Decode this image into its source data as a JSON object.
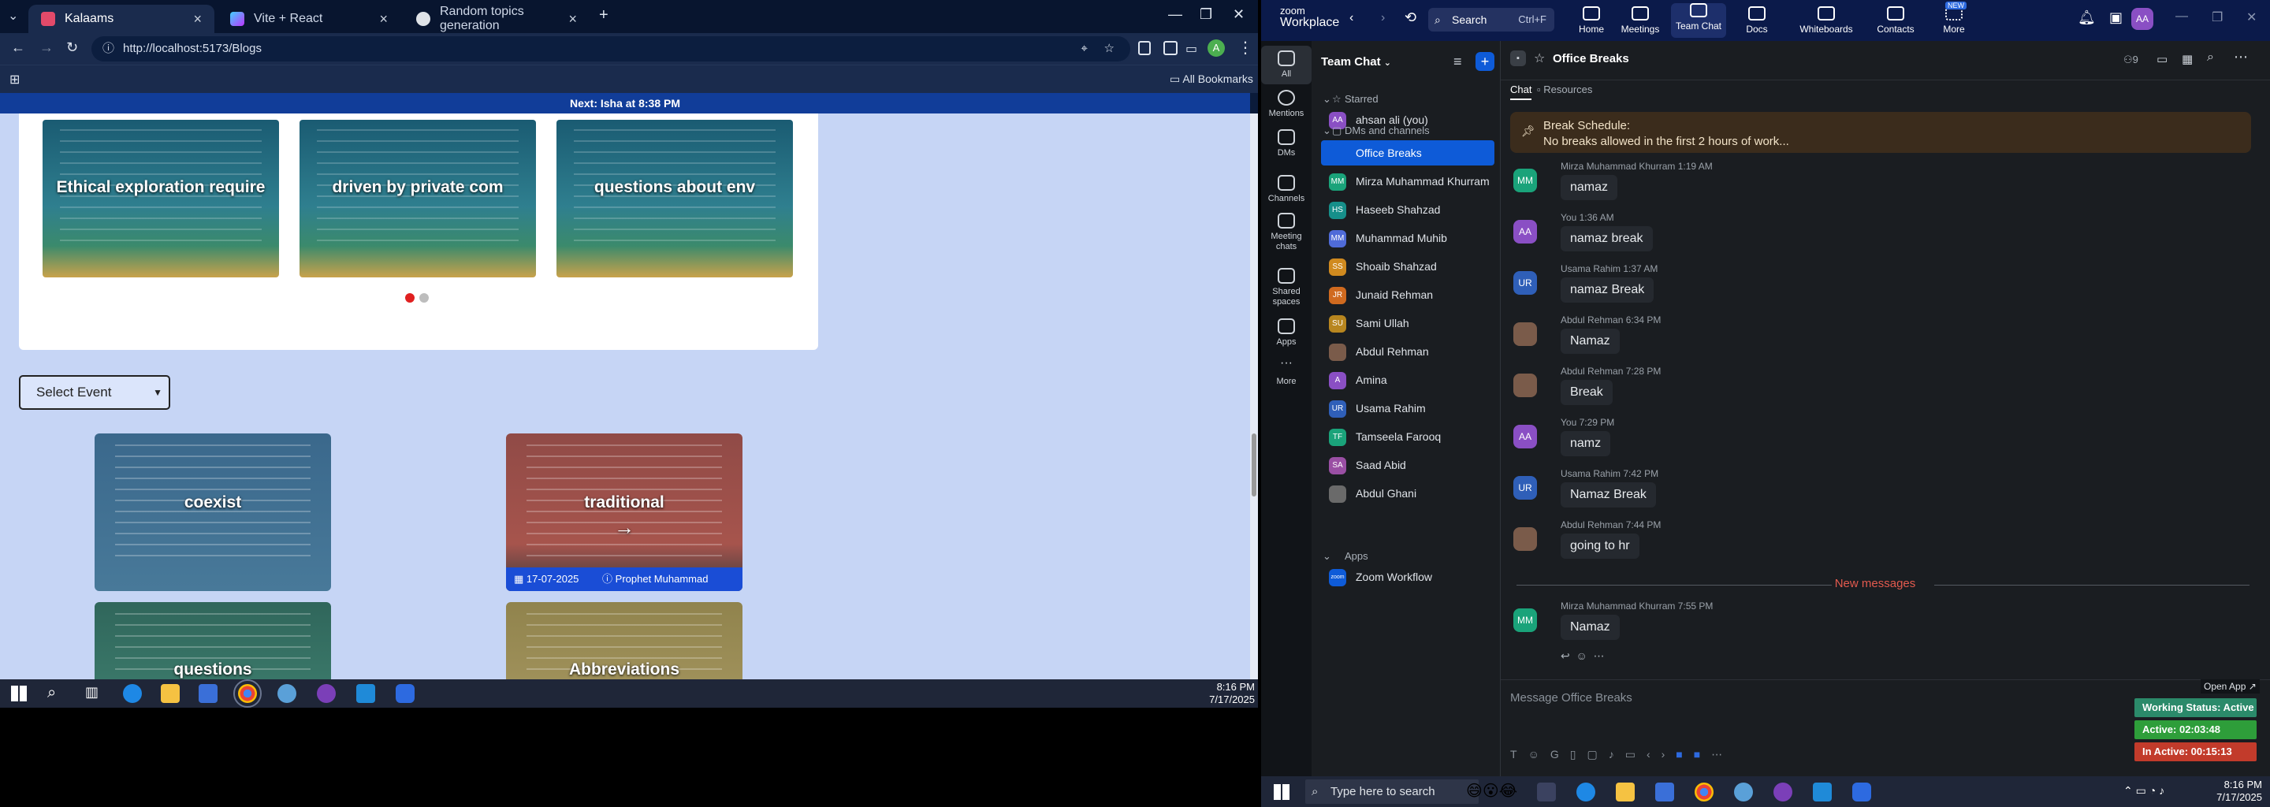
{
  "browser": {
    "tabs": [
      {
        "label": "Kalaams",
        "icon": "kalaams-favicon",
        "active": true
      },
      {
        "label": "Vite + React",
        "icon": "vite-favicon",
        "active": false
      },
      {
        "label": "Random topics generation",
        "icon": "chatgpt-favicon",
        "active": false
      }
    ],
    "url": "http://localhost:5173/Blogs",
    "all_bookmarks": "All Bookmarks",
    "profile_initial": "A"
  },
  "page": {
    "notice": "Next: Isha at 8:38 PM",
    "slides": [
      {
        "caption": "Ethical exploration require"
      },
      {
        "caption": "driven by private com"
      },
      {
        "caption": "questions about env"
      }
    ],
    "select_label": "Select Event",
    "events": [
      {
        "caption": "coexist"
      },
      {
        "caption": "traditional",
        "date": "17-07-2025",
        "author": "Prophet Muhammad (PBUH)",
        "arrow": "→"
      },
      {
        "caption": "questions"
      },
      {
        "caption": "Abbreviations"
      }
    ]
  },
  "left_taskbar": {
    "time": "8:16 PM",
    "date": "7/17/2025"
  },
  "zoom": {
    "brand_line1": "zoom",
    "brand_line2": "Workplace",
    "search_label": "Search",
    "search_shortcut": "Ctrl+F",
    "nav": [
      {
        "label": "Home"
      },
      {
        "label": "Meetings"
      },
      {
        "label": "Team Chat"
      },
      {
        "label": "Docs"
      },
      {
        "label": "Whiteboards"
      },
      {
        "label": "Contacts"
      },
      {
        "label": "More",
        "badge": "NEW"
      }
    ],
    "user_initials": "AA",
    "rail": [
      {
        "label": "All"
      },
      {
        "label": "Mentions"
      },
      {
        "label": "DMs"
      },
      {
        "label": "Channels"
      },
      {
        "label": "Meeting chats"
      },
      {
        "label": "Shared spaces"
      },
      {
        "label": "Apps"
      },
      {
        "label": "More"
      }
    ],
    "list_title": "Team Chat",
    "starred_label": "Starred",
    "starred_item": {
      "name": "ahsan ali (you)",
      "initials": "AA"
    },
    "dms_label": "DMs and channels",
    "channels": [
      {
        "name": "Office Breaks",
        "initials": "",
        "color": "#0e5bd8"
      },
      {
        "name": "Mirza Muhammad Khurram",
        "initials": "MM",
        "color": "#1aa37a"
      },
      {
        "name": "Haseeb Shahzad",
        "initials": "HS",
        "color": "#168f8a"
      },
      {
        "name": "Muhammad Muhib",
        "initials": "MM",
        "color": "#4f6bd8"
      },
      {
        "name": "Shoaib Shahzad",
        "initials": "SS",
        "color": "#d08a1f"
      },
      {
        "name": "Junaid Rehman",
        "initials": "JR",
        "color": "#d06a1f"
      },
      {
        "name": "Sami Ullah",
        "initials": "SU",
        "color": "#b8861f"
      },
      {
        "name": "Abdul Rehman",
        "initials": "",
        "color": "#7a5b4a"
      },
      {
        "name": "Amina",
        "initials": "A",
        "color": "#8a4fc4"
      },
      {
        "name": "Usama Rahim",
        "initials": "UR",
        "color": "#2f5fb8"
      },
      {
        "name": "Tamseela Farooq",
        "initials": "TF",
        "color": "#1aa37a"
      },
      {
        "name": "Saad Abid",
        "initials": "SA",
        "color": "#9a4fa4"
      },
      {
        "name": "Abdul Ghani",
        "initials": "",
        "color": "#6a6a6a"
      }
    ],
    "apps_label": "Apps",
    "apps_item": {
      "name": "Zoom Workflow",
      "initials": "zoom",
      "color": "#0e5bd8"
    },
    "chat_title": "Office Breaks",
    "member_count": "9",
    "chat_tab": "Chat",
    "resources_tab": "Resources",
    "pinned_title": "Break Schedule:",
    "pinned_text": "No breaks allowed in the first 2 hours of work...",
    "messages": [
      {
        "sender": "Mirza Muhammad Khurram",
        "time": "1:19 AM",
        "text": "namaz",
        "initials": "MM",
        "color": "#1aa37a"
      },
      {
        "sender": "You",
        "time": "1:36 AM",
        "text": "namaz break",
        "initials": "AA",
        "color": "#8a4fc4"
      },
      {
        "sender": "Usama Rahim",
        "time": "1:37 AM",
        "text": "namaz Break",
        "initials": "UR",
        "color": "#2f5fb8"
      },
      {
        "sender": "Abdul Rehman",
        "time": "6:34 PM",
        "text": "Namaz",
        "initials": "",
        "color": "#7a5b4a"
      },
      {
        "sender": "Abdul Rehman",
        "time": "7:28 PM",
        "text": "Break",
        "initials": "",
        "color": "#7a5b4a"
      },
      {
        "sender": "You",
        "time": "7:29 PM",
        "text": "namz",
        "initials": "AA",
        "color": "#8a4fc4"
      },
      {
        "sender": "Usama Rahim",
        "time": "7:42 PM",
        "text": "Namaz Break",
        "initials": "UR",
        "color": "#2f5fb8"
      },
      {
        "sender": "Abdul Rehman",
        "time": "7:44 PM",
        "text": "going to hr",
        "initials": "",
        "color": "#7a5b4a"
      }
    ],
    "new_messages_label": "New messages",
    "last_message": {
      "sender": "Mirza Muhammad Khurram",
      "time": "7:55 PM",
      "text": "Namaz",
      "initials": "MM",
      "color": "#1aa37a"
    },
    "composer_placeholder": "Message Office Breaks",
    "open_app": "Open App ↗",
    "status": [
      {
        "text": "Working Status: Active",
        "color": "#2b8a6a"
      },
      {
        "text": "Active: 02:03:48",
        "color": "#2e9e3a"
      },
      {
        "text": "In Active: 00:15:13",
        "color": "#c23b2b"
      }
    ]
  },
  "right_taskbar": {
    "search_placeholder": "Type here to search",
    "time": "8:16 PM",
    "date": "7/17/2025"
  }
}
